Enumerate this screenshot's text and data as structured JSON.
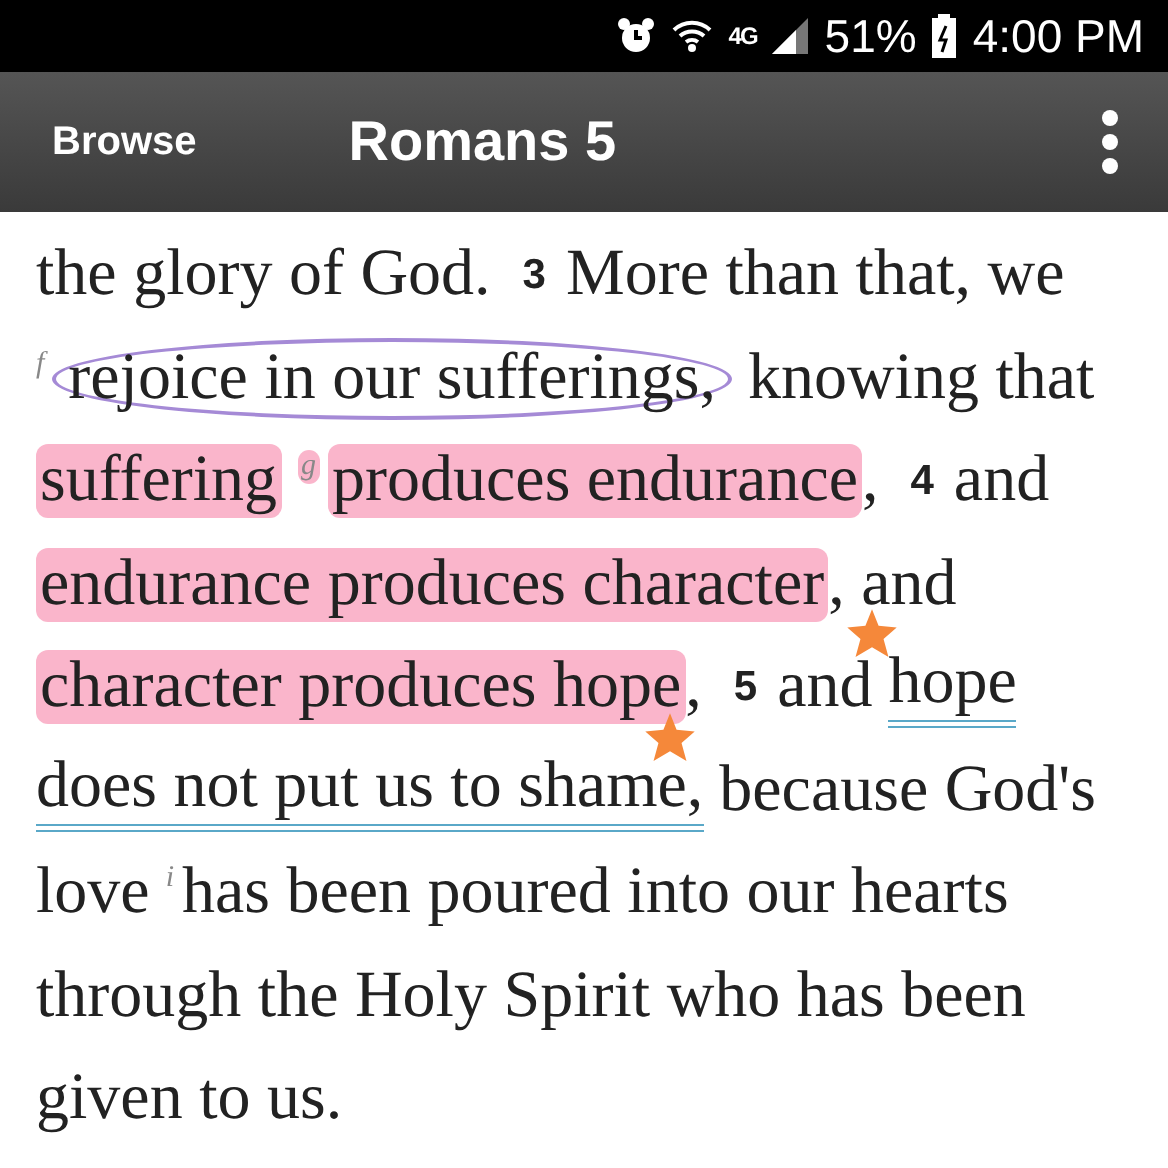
{
  "status_bar": {
    "network": "4G",
    "battery": "51%",
    "time": "4:00 PM"
  },
  "header": {
    "back_label": "Browse",
    "title": "Romans 5"
  },
  "passage": {
    "lines": [
      {
        "segments": [
          {
            "kind": "plain",
            "text": "the glory of God.",
            "highlighted": false,
            "circled": false,
            "underlined": false,
            "starred": false
          },
          {
            "kind": "verse",
            "text": "3",
            "highlighted": false,
            "circled": false,
            "underlined": false,
            "starred": false
          },
          {
            "kind": "plain",
            "text": "More than that, we",
            "highlighted": false,
            "circled": false,
            "underlined": false,
            "starred": false
          }
        ]
      },
      {
        "segments": [
          {
            "kind": "note",
            "text": "f",
            "highlighted": false,
            "circled": false,
            "underlined": false,
            "starred": false
          },
          {
            "kind": "plain",
            "text": "rejoice in our sufferings,",
            "highlighted": false,
            "circled": true,
            "underlined": false,
            "starred": false
          },
          {
            "kind": "plain",
            "text": "knowing that",
            "highlighted": false,
            "circled": false,
            "underlined": false,
            "starred": false
          }
        ]
      },
      {
        "segments": [
          {
            "kind": "plain",
            "text": "suffering",
            "highlighted": true,
            "circled": false,
            "underlined": false,
            "starred": false
          },
          {
            "kind": "note",
            "text": "g",
            "highlighted": true,
            "circled": false,
            "underlined": false,
            "starred": false
          },
          {
            "kind": "plain",
            "text": "produces endurance",
            "highlighted": true,
            "circled": false,
            "underlined": false,
            "starred": false
          },
          {
            "kind": "plain",
            "text": ",",
            "highlighted": false,
            "circled": false,
            "underlined": false,
            "starred": false
          },
          {
            "kind": "verse",
            "text": "4",
            "highlighted": false,
            "circled": false,
            "underlined": false,
            "starred": false
          },
          {
            "kind": "plain",
            "text": "and",
            "highlighted": false,
            "circled": false,
            "underlined": false,
            "starred": false
          }
        ]
      },
      {
        "segments": [
          {
            "kind": "plain",
            "text": "endurance produces character",
            "highlighted": true,
            "circled": false,
            "underlined": false,
            "starred": false
          },
          {
            "kind": "plain",
            "text": ", and",
            "highlighted": false,
            "circled": false,
            "underlined": false,
            "starred": false
          }
        ]
      },
      {
        "segments": [
          {
            "kind": "plain",
            "text": "character produces hope",
            "highlighted": true,
            "circled": false,
            "underlined": false,
            "starred": false
          },
          {
            "kind": "plain",
            "text": ",",
            "highlighted": false,
            "circled": false,
            "underlined": false,
            "starred": false
          },
          {
            "kind": "verse",
            "text": "5",
            "highlighted": false,
            "circled": false,
            "underlined": false,
            "starred": false
          },
          {
            "kind": "plain",
            "text": "and",
            "highlighted": false,
            "circled": false,
            "underlined": false,
            "starred": false
          },
          {
            "kind": "plain",
            "text": "hope",
            "highlighted": false,
            "circled": false,
            "underlined": true,
            "starred": true
          }
        ]
      },
      {
        "segments": [
          {
            "kind": "plain",
            "text": "does not put us to shame",
            "highlighted": false,
            "circled": false,
            "underlined": true,
            "starred": false
          },
          {
            "kind": "plain",
            "text": ",",
            "highlighted": false,
            "circled": false,
            "underlined": true,
            "starred": true
          },
          {
            "kind": "plain",
            "text": "because God's",
            "highlighted": false,
            "circled": false,
            "underlined": false,
            "starred": false
          }
        ]
      },
      {
        "segments": [
          {
            "kind": "plain",
            "text": "love",
            "highlighted": false,
            "circled": false,
            "underlined": false,
            "starred": false
          },
          {
            "kind": "note",
            "text": "i",
            "highlighted": false,
            "circled": false,
            "underlined": false,
            "starred": false
          },
          {
            "kind": "plain",
            "text": "has been poured into our hearts",
            "highlighted": false,
            "circled": false,
            "underlined": false,
            "starred": false
          }
        ]
      },
      {
        "segments": [
          {
            "kind": "plain",
            "text": "through the Holy Spirit who has been",
            "highlighted": false,
            "circled": false,
            "underlined": false,
            "starred": false
          }
        ]
      },
      {
        "segments": [
          {
            "kind": "plain",
            "text": "given to us.",
            "highlighted": false,
            "circled": false,
            "underlined": false,
            "starred": false
          }
        ]
      }
    ]
  }
}
